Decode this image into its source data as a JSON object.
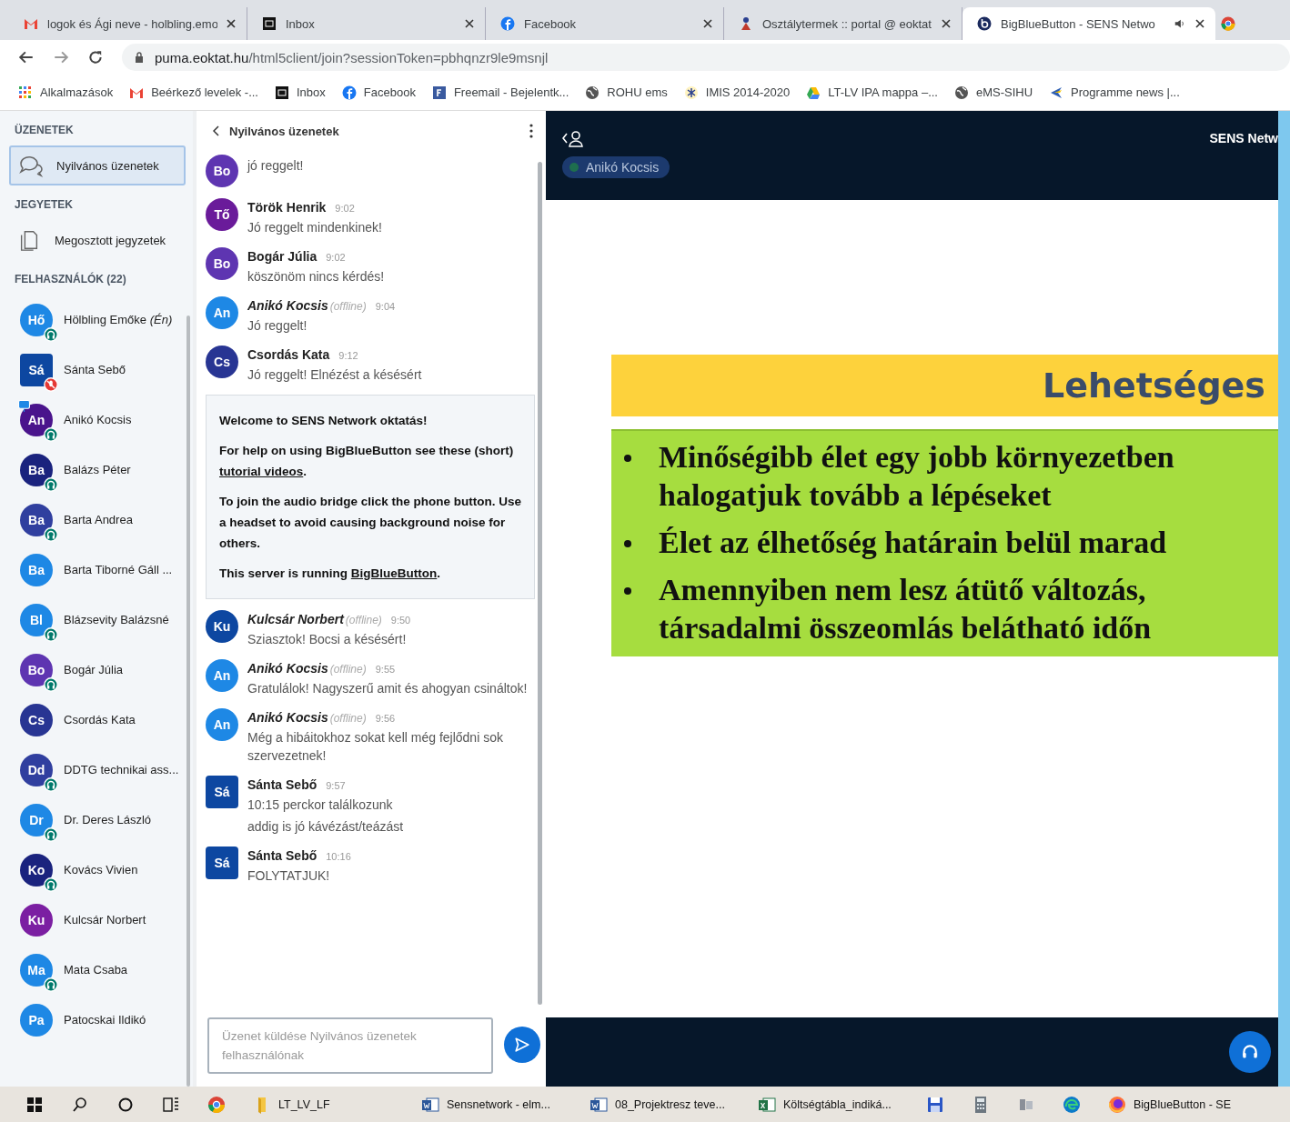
{
  "browser": {
    "tabs": [
      {
        "title": "logok és Ági neve - holbling.emo",
        "selected": false,
        "audio": false
      },
      {
        "title": "Inbox",
        "selected": false,
        "audio": false
      },
      {
        "title": "Facebook",
        "selected": false,
        "audio": false
      },
      {
        "title": "Osztálytermek :: portal @ eoktat",
        "selected": false,
        "audio": false
      },
      {
        "title": "BigBlueButton - SENS Netwo",
        "selected": true,
        "audio": true
      }
    ],
    "address": {
      "host": "puma.eoktat.hu",
      "path": "/html5client/join?sessionToken=pbhqnzr9le9msnjl"
    },
    "bookmarks": [
      {
        "label": "Alkalmazások"
      },
      {
        "label": "Beérkező levelek -..."
      },
      {
        "label": "Inbox"
      },
      {
        "label": "Facebook"
      },
      {
        "label": "Freemail - Bejelentk..."
      },
      {
        "label": "ROHU ems"
      },
      {
        "label": "IMIS 2014-2020"
      },
      {
        "label": "LT-LV IPA mappa –..."
      },
      {
        "label": "eMS-SIHU"
      },
      {
        "label": "Programme news |..."
      }
    ]
  },
  "sidebar": {
    "messages_heading": "ÜZENETEK",
    "chat_item": {
      "label": "Nyilvános üzenetek",
      "selected": true
    },
    "notes_heading": "JEGYETEK",
    "notes_item": {
      "label": "Megosztott jegyzetek",
      "selected": false
    },
    "users_heading": "FELHASZNÁLÓK (22)",
    "users": [
      {
        "initials": "Hő",
        "name": "Hölbling Emőke *(Én)*",
        "color": "#1e88e5",
        "moderator": false,
        "presenter": false,
        "headset": true,
        "muted": false
      },
      {
        "initials": "Sá",
        "name": "Sánta Sebő",
        "color": "#0d47a1",
        "moderator": true,
        "presenter": false,
        "headset": false,
        "muted": true
      },
      {
        "initials": "An",
        "name": "Anikó Kocsis",
        "color": "#4a148c",
        "moderator": false,
        "presenter": true,
        "headset": true,
        "muted": false
      },
      {
        "initials": "Ba",
        "name": "Balázs Péter",
        "color": "#1a237e",
        "moderator": false,
        "presenter": false,
        "headset": true,
        "muted": false
      },
      {
        "initials": "Ba",
        "name": "Barta Andrea",
        "color": "#303f9f",
        "moderator": false,
        "presenter": false,
        "headset": true,
        "muted": false
      },
      {
        "initials": "Ba",
        "name": "Barta Tiborné Gáll ...",
        "color": "#1e88e5",
        "moderator": false,
        "presenter": false,
        "headset": false,
        "muted": false
      },
      {
        "initials": "Bl",
        "name": "Blázsevity Balázsné",
        "color": "#1e88e5",
        "moderator": false,
        "presenter": false,
        "headset": true,
        "muted": false
      },
      {
        "initials": "Bo",
        "name": "Bogár Júlia",
        "color": "#5e35b1",
        "moderator": false,
        "presenter": false,
        "headset": true,
        "muted": false
      },
      {
        "initials": "Cs",
        "name": "Csordás Kata",
        "color": "#283593",
        "moderator": false,
        "presenter": false,
        "headset": false,
        "muted": false
      },
      {
        "initials": "Dd",
        "name": "DDTG technikai ass...",
        "color": "#303f9f",
        "moderator": false,
        "presenter": false,
        "headset": true,
        "muted": false
      },
      {
        "initials": "Dr",
        "name": "Dr. Deres László",
        "color": "#1e88e5",
        "moderator": false,
        "presenter": false,
        "headset": true,
        "muted": false
      },
      {
        "initials": "Ko",
        "name": "Kovács Vivien",
        "color": "#1a237e",
        "moderator": false,
        "presenter": false,
        "headset": true,
        "muted": false
      },
      {
        "initials": "Ku",
        "name": "Kulcsár Norbert",
        "color": "#7b1fa2",
        "moderator": false,
        "presenter": false,
        "headset": false,
        "muted": false
      },
      {
        "initials": "Ma",
        "name": "Mata Csaba",
        "color": "#1e88e5",
        "moderator": false,
        "presenter": false,
        "headset": true,
        "muted": false
      },
      {
        "initials": "Pa",
        "name": "Patocskai Ildikó",
        "color": "#1e88e5",
        "moderator": false,
        "presenter": false,
        "headset": false,
        "muted": false
      }
    ]
  },
  "chat": {
    "title": "Nyilvános üzenetek",
    "messages": [
      {
        "kind": "message",
        "initials": "Bo",
        "color": "#5e35b1",
        "moderator": false,
        "lines": [
          "jó reggelt!"
        ]
      },
      {
        "kind": "message",
        "initials": "Tő",
        "color": "#6a1b9a",
        "moderator": false,
        "name": "Török Henrik",
        "offline": false,
        "time": "9:02",
        "lines": [
          "Jó reggelt mindenkinek!"
        ]
      },
      {
        "kind": "message",
        "initials": "Bo",
        "color": "#5e35b1",
        "moderator": false,
        "name": "Bogár Júlia",
        "offline": false,
        "time": "9:02",
        "lines": [
          "köszönöm nincs kérdés!"
        ]
      },
      {
        "kind": "message",
        "initials": "An",
        "color": "#1e88e5",
        "moderator": false,
        "name": "Anikó Kocsis",
        "offline": true,
        "status": "(offline)",
        "time": "9:04",
        "lines": [
          "Jó reggelt!"
        ]
      },
      {
        "kind": "message",
        "initials": "Cs",
        "color": "#283593",
        "moderator": false,
        "name": "Csordás Kata",
        "offline": false,
        "time": "9:12",
        "lines": [
          "Jó reggelt! Elnézést a késésért"
        ]
      },
      {
        "kind": "welcome",
        "paragraphs": [
          [
            {
              "text": "Welcome to SENS Network oktatás!",
              "link": false
            }
          ],
          [
            {
              "text": "For help on using BigBlueButton see these (short) ",
              "link": false
            },
            {
              "text": "tutorial videos",
              "link": true
            },
            {
              "text": ".",
              "link": false
            }
          ],
          [
            {
              "text": "To join the audio bridge click the phone button. Use a headset to avoid causing background noise for others.",
              "link": false
            }
          ],
          [
            {
              "text": "This server is running ",
              "link": false
            },
            {
              "text": "BigBlueButton",
              "link": true
            },
            {
              "text": ".",
              "link": false
            }
          ]
        ]
      },
      {
        "kind": "message",
        "initials": "Ku",
        "color": "#0d47a1",
        "moderator": false,
        "name": "Kulcsár Norbert",
        "offline": true,
        "status": "(offline)",
        "time": "9:50",
        "lines": [
          "Sziasztok! Bocsi a késésért!"
        ]
      },
      {
        "kind": "message",
        "initials": "An",
        "color": "#1e88e5",
        "moderator": false,
        "name": "Anikó Kocsis",
        "offline": true,
        "status": "(offline)",
        "time": "9:55",
        "lines": [
          "Gratulálok! Nagyszerű amit és ahogyan csináltok!"
        ]
      },
      {
        "kind": "message",
        "initials": "An",
        "color": "#1e88e5",
        "moderator": false,
        "name": "Anikó Kocsis",
        "offline": true,
        "status": "(offline)",
        "time": "9:56",
        "lines": [
          "Még a hibáitokhoz sokat kell még fejlődni sok szervezetnek!"
        ]
      },
      {
        "kind": "message",
        "initials": "Sá",
        "color": "#0d47a1",
        "moderator": true,
        "name": "Sánta Sebő",
        "offline": false,
        "time": "9:57",
        "lines": [
          "10:15 perckor találkozunk",
          "addig is jó kávézást/teázást"
        ]
      },
      {
        "kind": "message",
        "initials": "Sá",
        "color": "#0d47a1",
        "moderator": true,
        "name": "Sánta Sebő",
        "offline": false,
        "time": "10:16",
        "lines": [
          "FOLYTATJUK!"
        ]
      }
    ],
    "input": {
      "placeholder": "Üzenet küldése Nyilvános üzenetek felhasználónak"
    }
  },
  "presentation": {
    "meeting_name": "SENS Netw",
    "talker": {
      "name": "Anikó Kocsis",
      "talking": true
    },
    "slide": {
      "title": "Lehetséges",
      "bullets": [
        "Minőségibb élet egy jobb környezetben halogatjuk tovább a lépéseket",
        "Élet az élhetőség határain belül marad",
        "Amennyiben nem lesz átütő változás, társadalmi összeomlás belátható időn"
      ]
    }
  },
  "taskbar": [
    {
      "kind": "windows"
    },
    {
      "kind": "search"
    },
    {
      "kind": "cortana"
    },
    {
      "kind": "taskview"
    },
    {
      "kind": "chrome"
    },
    {
      "kind": "folder",
      "label": "LT_LV_LF"
    },
    {
      "kind": "word",
      "label": "Sensnetwork - elm..."
    },
    {
      "kind": "word",
      "label": "08_Projektresz teve..."
    },
    {
      "kind": "excel",
      "label": "Költségtábla_indiká..."
    },
    {
      "kind": "save"
    },
    {
      "kind": "calculator"
    },
    {
      "kind": "app"
    },
    {
      "kind": "edge"
    },
    {
      "kind": "firefox",
      "label": "BigBlueButton - SE"
    }
  ]
}
